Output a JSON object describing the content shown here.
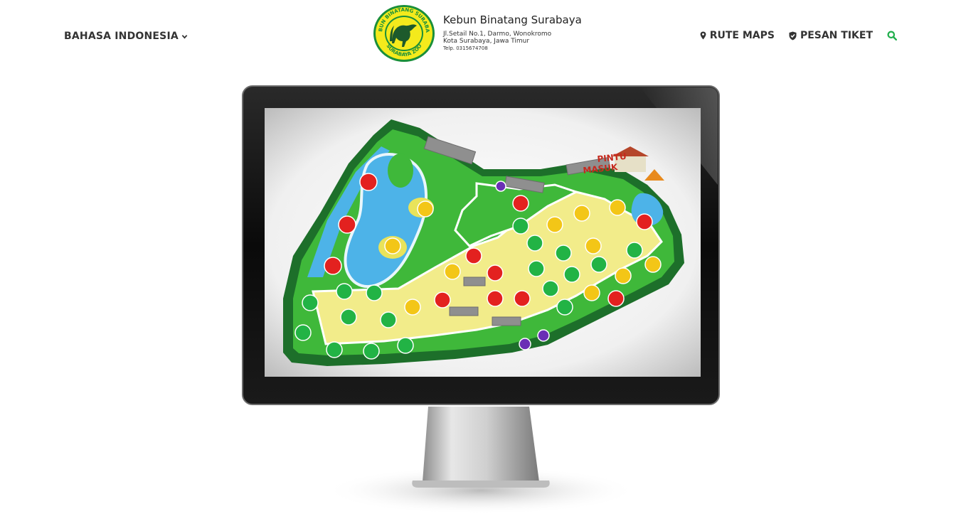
{
  "header": {
    "language_label": "BAHASA INDONESIA",
    "brand": {
      "name": "Kebun Binatang Surabaya",
      "address_line1": "Jl.Setail No.1, Darmo, Wonokromo",
      "address_line2": "Kota Surabaya, Jawa Timur",
      "phone": "Telp. 0315674708",
      "logo_top_text": "KEBUN BINATANG SURABAYA",
      "logo_bottom_text": "SURABAYA ZOO"
    },
    "nav": {
      "rute_maps": "RUTE MAPS",
      "pesan_tiket": "PESAN TIKET"
    }
  },
  "map": {
    "entrance_line1": "PINTU",
    "entrance_line2": "MASUK"
  },
  "colors": {
    "accent_green": "#1fae4b",
    "logo_yellow": "#f4ea1c",
    "logo_green": "#1a8f3a",
    "marker_red": "#e3211f",
    "marker_yellow": "#f3c617",
    "marker_green": "#22b345",
    "path_yellow": "#f2ec8a",
    "lake_blue": "#4db3e8",
    "grass_green": "#3fb83a"
  }
}
